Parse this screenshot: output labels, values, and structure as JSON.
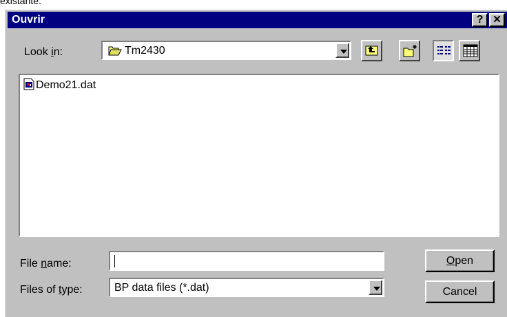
{
  "background": {
    "partial_text": "existante."
  },
  "window": {
    "title": "Ouvrir",
    "help_glyph": "?",
    "close_glyph": "✕",
    "title_bar_color": "#000080",
    "face_color": "#c0c0c0"
  },
  "look_in": {
    "label_pre": "Look ",
    "label_key": "i",
    "label_post": "n:",
    "value": "Tm2430",
    "folder_icon": "open-folder-icon"
  },
  "toolbar": {
    "icons": [
      "up-one-level-icon",
      "create-new-folder-icon",
      "list-view-icon",
      "details-view-icon"
    ]
  },
  "files": [
    {
      "name": "Demo21.dat",
      "icon": "data-file-icon"
    }
  ],
  "file_name": {
    "label_pre": "File ",
    "label_key": "n",
    "label_post": "ame:",
    "value": ""
  },
  "file_type": {
    "label_pre": "Files of ",
    "label_key": "t",
    "label_post": "ype:",
    "value": "BP data files (*.dat)"
  },
  "buttons": {
    "open_key": "O",
    "open_rest": "pen",
    "cancel": "Cancel"
  }
}
